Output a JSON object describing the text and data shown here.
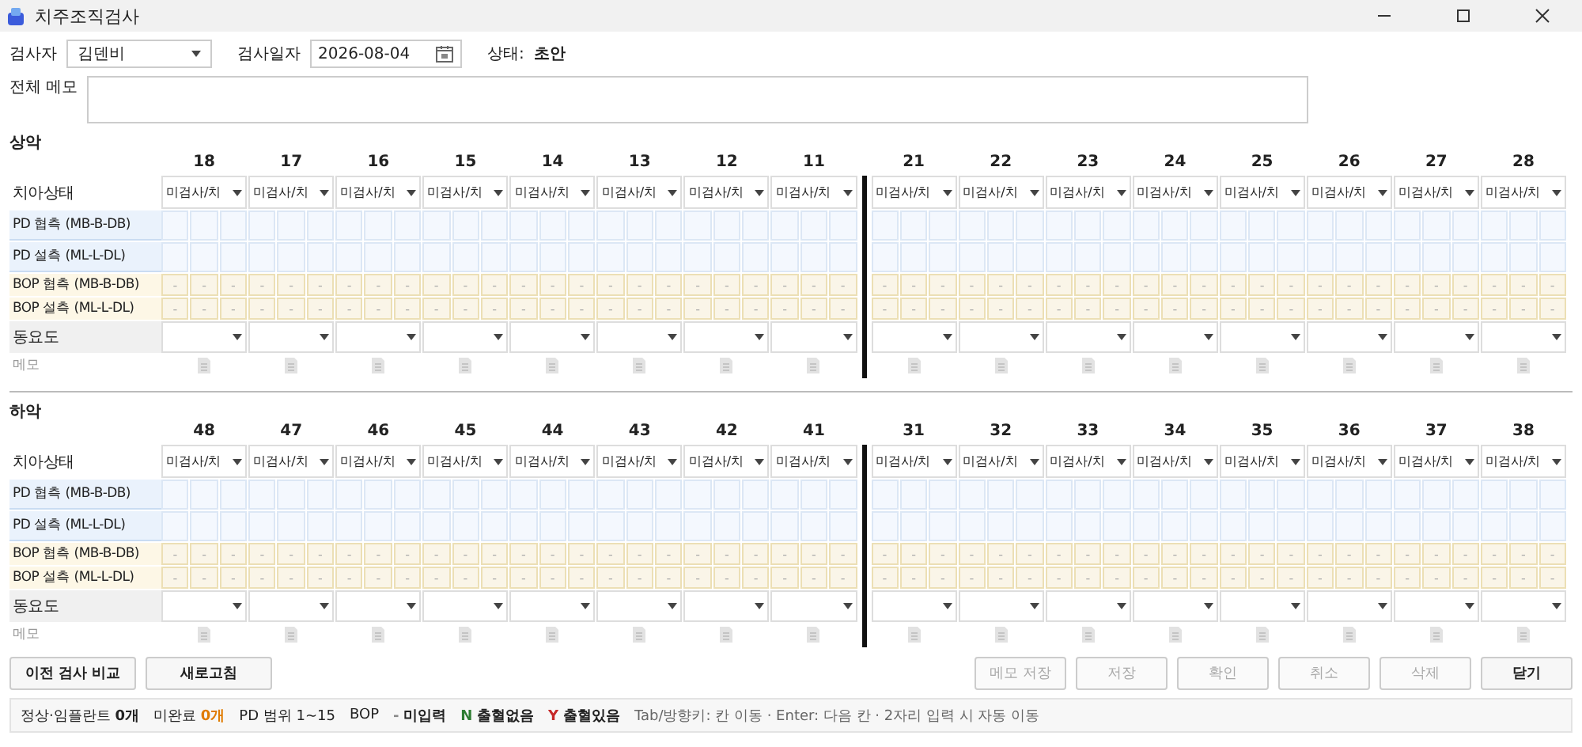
{
  "window": {
    "title": "치주조직검사"
  },
  "header": {
    "examiner": {
      "label": "검사자",
      "value": "김덴비"
    },
    "date": {
      "label": "검사일자",
      "value": "2026-08-04"
    },
    "status": {
      "label": "상태:",
      "value": "초안"
    }
  },
  "memo": {
    "label": "전체 메모"
  },
  "arches": [
    {
      "title": "상악",
      "rows": [
        {
          "kind": "status",
          "label": "치아상태"
        },
        {
          "kind": "pd",
          "label": "PD 협측 (MB-B-DB)"
        },
        {
          "kind": "pd",
          "label": "PD 설측 (ML-L-DL)"
        },
        {
          "kind": "bop",
          "label": "BOP 협측 (MB-B-DB)"
        },
        {
          "kind": "bop",
          "label": "BOP 설측 (ML-L-DL)"
        },
        {
          "kind": "mobility",
          "label": "동요도"
        },
        {
          "kind": "memo",
          "label": "메모"
        }
      ],
      "teeth": [
        {
          "number": "18",
          "status": "미검사/치",
          "bop": [
            [
              "-",
              "-",
              "-"
            ],
            [
              "-",
              "-",
              "-"
            ]
          ]
        },
        {
          "number": "17",
          "status": "미검사/치",
          "bop": [
            [
              "-",
              "-",
              "-"
            ],
            [
              "-",
              "-",
              "-"
            ]
          ]
        },
        {
          "number": "16",
          "status": "미검사/치",
          "bop": [
            [
              "-",
              "-",
              "-"
            ],
            [
              "-",
              "-",
              "-"
            ]
          ]
        },
        {
          "number": "15",
          "status": "미검사/치",
          "bop": [
            [
              "-",
              "-",
              "-"
            ],
            [
              "-",
              "-",
              "-"
            ]
          ]
        },
        {
          "number": "14",
          "status": "미검사/치",
          "bop": [
            [
              "-",
              "-",
              "-"
            ],
            [
              "-",
              "-",
              "-"
            ]
          ]
        },
        {
          "number": "13",
          "status": "미검사/치",
          "bop": [
            [
              "-",
              "-",
              "-"
            ],
            [
              "-",
              "-",
              "-"
            ]
          ]
        },
        {
          "number": "12",
          "status": "미검사/치",
          "bop": [
            [
              "-",
              "-",
              "-"
            ],
            [
              "-",
              "-",
              "-"
            ]
          ]
        },
        {
          "number": "11",
          "status": "미검사/치",
          "bop": [
            [
              "-",
              "-",
              "-"
            ],
            [
              "-",
              "-",
              "-"
            ]
          ]
        },
        {
          "number": "21",
          "status": "미검사/치",
          "bop": [
            [
              "-",
              "-",
              "-"
            ],
            [
              "-",
              "-",
              "-"
            ]
          ]
        },
        {
          "number": "22",
          "status": "미검사/치",
          "bop": [
            [
              "-",
              "-",
              "-"
            ],
            [
              "-",
              "-",
              "-"
            ]
          ]
        },
        {
          "number": "23",
          "status": "미검사/치",
          "bop": [
            [
              "-",
              "-",
              "-"
            ],
            [
              "-",
              "-",
              "-"
            ]
          ]
        },
        {
          "number": "24",
          "status": "미검사/치",
          "bop": [
            [
              "-",
              "-",
              "-"
            ],
            [
              "-",
              "-",
              "-"
            ]
          ]
        },
        {
          "number": "25",
          "status": "미검사/치",
          "bop": [
            [
              "-",
              "-",
              "-"
            ],
            [
              "-",
              "-",
              "-"
            ]
          ]
        },
        {
          "number": "26",
          "status": "미검사/치",
          "bop": [
            [
              "-",
              "-",
              "-"
            ],
            [
              "-",
              "-",
              "-"
            ]
          ]
        },
        {
          "number": "27",
          "status": "미검사/치",
          "bop": [
            [
              "-",
              "-",
              "-"
            ],
            [
              "-",
              "-",
              "-"
            ]
          ]
        },
        {
          "number": "28",
          "status": "미검사/치",
          "bop": [
            [
              "-",
              "-",
              "-"
            ],
            [
              "-",
              "-",
              "-"
            ]
          ]
        }
      ]
    },
    {
      "title": "하악",
      "rows": [
        {
          "kind": "status",
          "label": "치아상태"
        },
        {
          "kind": "pd",
          "label": "PD 협측 (MB-B-DB)"
        },
        {
          "kind": "pd",
          "label": "PD 설측 (ML-L-DL)"
        },
        {
          "kind": "bop",
          "label": "BOP 협측 (MB-B-DB)"
        },
        {
          "kind": "bop",
          "label": "BOP 설측 (ML-L-DL)"
        },
        {
          "kind": "mobility",
          "label": "동요도"
        },
        {
          "kind": "memo",
          "label": "메모"
        }
      ],
      "teeth": [
        {
          "number": "48",
          "status": "미검사/치",
          "bop": [
            [
              "-",
              "-",
              "-"
            ],
            [
              "-",
              "-",
              "-"
            ]
          ]
        },
        {
          "number": "47",
          "status": "미검사/치",
          "bop": [
            [
              "-",
              "-",
              "-"
            ],
            [
              "-",
              "-",
              "-"
            ]
          ]
        },
        {
          "number": "46",
          "status": "미검사/치",
          "bop": [
            [
              "-",
              "-",
              "-"
            ],
            [
              "-",
              "-",
              "-"
            ]
          ]
        },
        {
          "number": "45",
          "status": "미검사/치",
          "bop": [
            [
              "-",
              "-",
              "-"
            ],
            [
              "-",
              "-",
              "-"
            ]
          ]
        },
        {
          "number": "44",
          "status": "미검사/치",
          "bop": [
            [
              "-",
              "-",
              "-"
            ],
            [
              "-",
              "-",
              "-"
            ]
          ]
        },
        {
          "number": "43",
          "status": "미검사/치",
          "bop": [
            [
              "-",
              "-",
              "-"
            ],
            [
              "-",
              "-",
              "-"
            ]
          ]
        },
        {
          "number": "42",
          "status": "미검사/치",
          "bop": [
            [
              "-",
              "-",
              "-"
            ],
            [
              "-",
              "-",
              "-"
            ]
          ]
        },
        {
          "number": "41",
          "status": "미검사/치",
          "bop": [
            [
              "-",
              "-",
              "-"
            ],
            [
              "-",
              "-",
              "-"
            ]
          ]
        },
        {
          "number": "31",
          "status": "미검사/치",
          "bop": [
            [
              "-",
              "-",
              "-"
            ],
            [
              "-",
              "-",
              "-"
            ]
          ]
        },
        {
          "number": "32",
          "status": "미검사/치",
          "bop": [
            [
              "-",
              "-",
              "-"
            ],
            [
              "-",
              "-",
              "-"
            ]
          ]
        },
        {
          "number": "33",
          "status": "미검사/치",
          "bop": [
            [
              "-",
              "-",
              "-"
            ],
            [
              "-",
              "-",
              "-"
            ]
          ]
        },
        {
          "number": "34",
          "status": "미검사/치",
          "bop": [
            [
              "-",
              "-",
              "-"
            ],
            [
              "-",
              "-",
              "-"
            ]
          ]
        },
        {
          "number": "35",
          "status": "미검사/치",
          "bop": [
            [
              "-",
              "-",
              "-"
            ],
            [
              "-",
              "-",
              "-"
            ]
          ]
        },
        {
          "number": "36",
          "status": "미검사/치",
          "bop": [
            [
              "-",
              "-",
              "-"
            ],
            [
              "-",
              "-",
              "-"
            ]
          ]
        },
        {
          "number": "37",
          "status": "미검사/치",
          "bop": [
            [
              "-",
              "-",
              "-"
            ],
            [
              "-",
              "-",
              "-"
            ]
          ]
        },
        {
          "number": "38",
          "status": "미검사/치",
          "bop": [
            [
              "-",
              "-",
              "-"
            ],
            [
              "-",
              "-",
              "-"
            ]
          ]
        }
      ]
    }
  ],
  "buttons_left": [
    {
      "label": "이전 검사 비교",
      "disabled": false
    },
    {
      "label": "새로고침",
      "disabled": false
    }
  ],
  "buttons_right": [
    {
      "label": "메모 저장",
      "disabled": true
    },
    {
      "label": "저장",
      "disabled": true
    },
    {
      "label": "확인",
      "disabled": true
    },
    {
      "label": "취소",
      "disabled": true
    },
    {
      "label": "삭제",
      "disabled": true
    },
    {
      "label": "닫기",
      "disabled": false
    }
  ],
  "status_bar": {
    "counts": [
      {
        "label": "정상·임플란트",
        "count": "0개",
        "color": "#222222"
      },
      {
        "label": "미완료",
        "count": "0개",
        "color": "#e07b00"
      }
    ],
    "pd_range": "PD 범위 1~15",
    "bop_label": "BOP",
    "legend": [
      {
        "symbol": "-",
        "text": "미입력",
        "color": "#888888"
      },
      {
        "symbol": "N",
        "text": "출혈없음",
        "color": "#2e7d32"
      },
      {
        "symbol": "Y",
        "text": "출혈있음",
        "color": "#c62828"
      }
    ],
    "hint": "Tab/방향키: 칸 이동 · Enter: 다음 칸 · 2자리 입력 시 자동 이동"
  }
}
